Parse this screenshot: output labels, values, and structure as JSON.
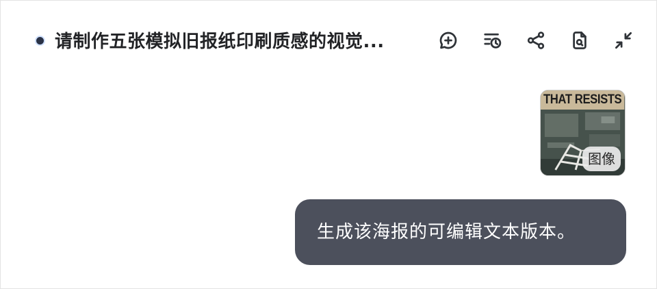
{
  "header": {
    "title": "请制作五张模拟旧报纸印刷质感的视觉...",
    "icons": [
      "new-chat-icon",
      "history-icon",
      "share-icon",
      "document-search-icon",
      "collapse-icon"
    ]
  },
  "attachment": {
    "headline": "THAT RESISTS",
    "badge": "图像"
  },
  "message": {
    "text": "生成该海报的可编辑文本版本。"
  },
  "colors": {
    "bubble_bg": "#4c505c",
    "title": "#222326",
    "icon": "#2f3338"
  }
}
